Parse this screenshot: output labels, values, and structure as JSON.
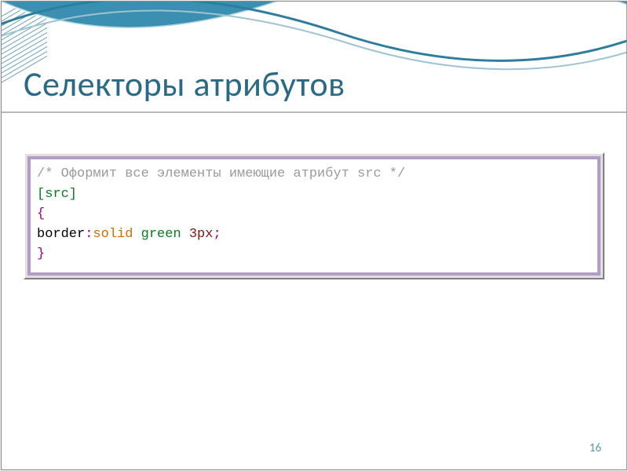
{
  "title": "Селекторы атрибутов",
  "page_number": "16",
  "code": {
    "comment": "/* Оформит все элементы имеющие атрибут src */",
    "selector": "[src]",
    "brace_open": "{",
    "prop": "border",
    "colon": ":",
    "val_kw": "solid",
    "val": "green",
    "num": "3px",
    "semi": ";",
    "brace_close": "}"
  },
  "colors": {
    "title": "#2a6a86",
    "wave": "#308aae",
    "code_border": "#b49bc8"
  }
}
